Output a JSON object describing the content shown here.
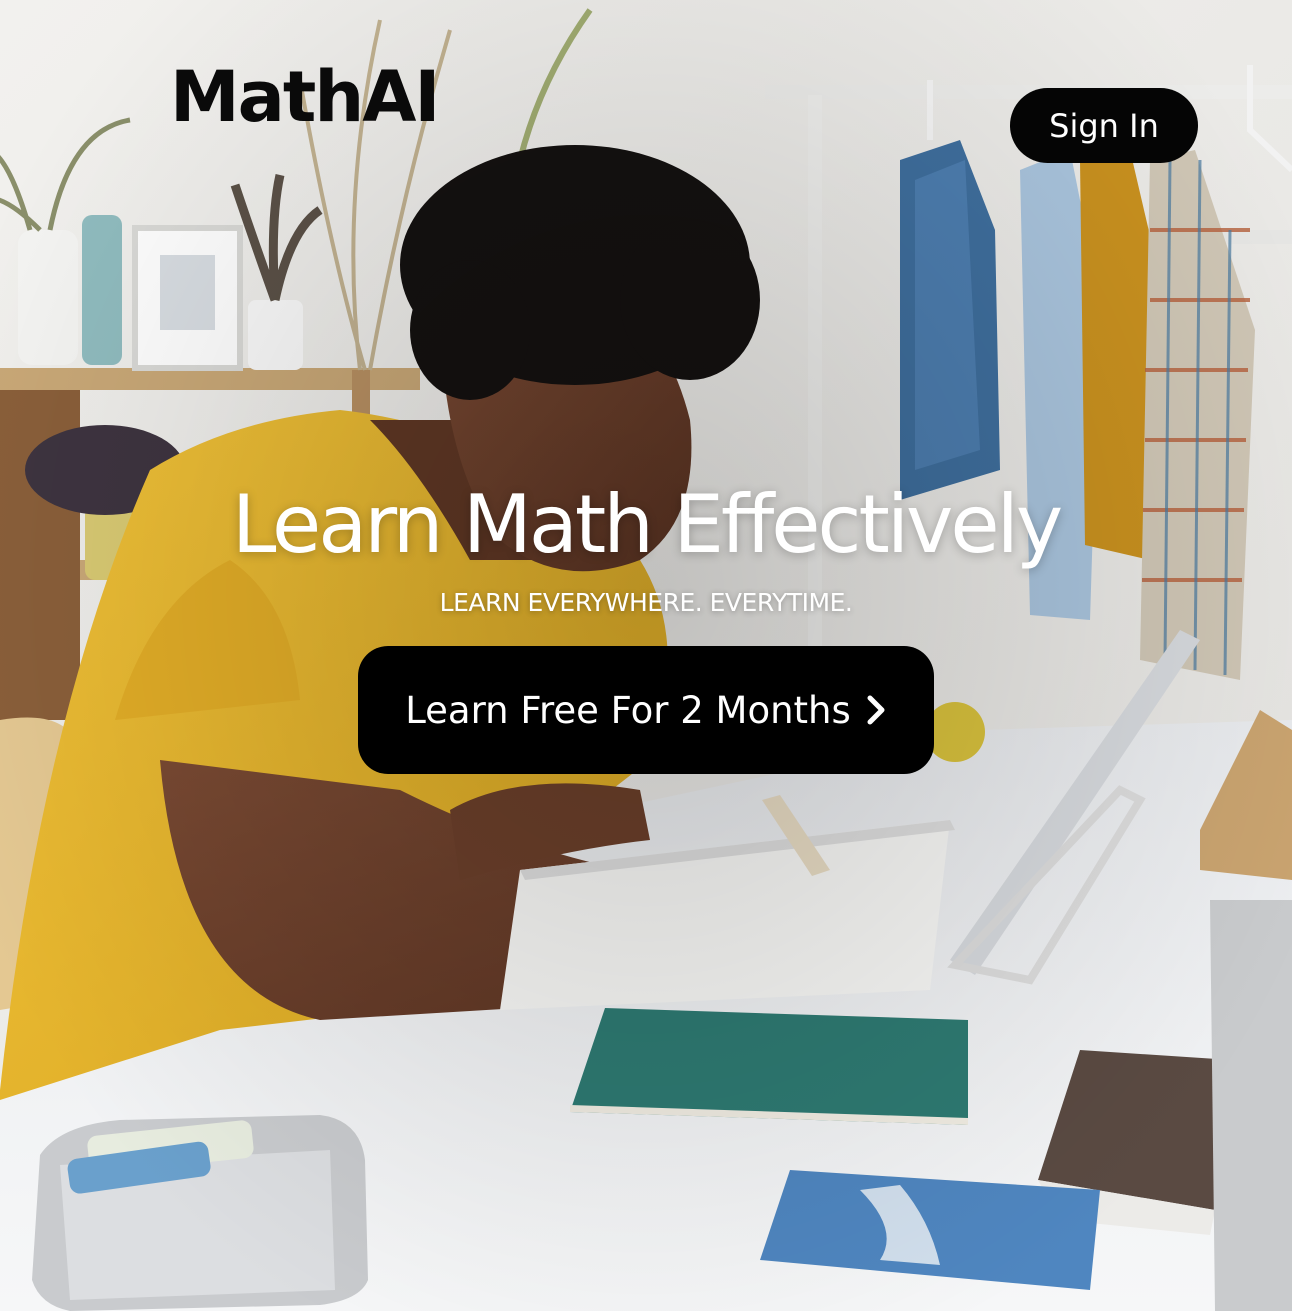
{
  "header": {
    "logo_text": "MathAI",
    "sign_in_label": "Sign In"
  },
  "hero": {
    "headline": "Learn Math Effectively",
    "tagline": "LEARN EVERYWHERE. EVERYTIME.",
    "cta_label": "Learn Free For 2 Months",
    "cta_icon": "chevron-right-icon",
    "background_image": "photo-student-writing-at-desk"
  },
  "colors": {
    "button_bg": "#000000",
    "button_text": "#ffffff",
    "logo": "#0a0a0a",
    "headline": "#ffffff",
    "shirt_accent": "#e8b62c",
    "notebook_teal": "#2e7a72"
  }
}
